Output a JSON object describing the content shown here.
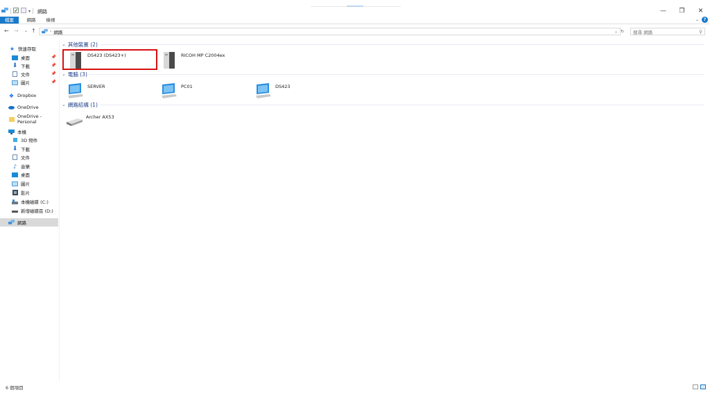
{
  "window": {
    "title": "網路",
    "minimize": "—",
    "maximize": "❐",
    "close": "✕"
  },
  "ribbon": {
    "tabs": [
      "檔案",
      "網路",
      "檢視"
    ],
    "help": "?"
  },
  "address": {
    "path": "網路",
    "search_placeholder": "搜尋 網路"
  },
  "nav": {
    "quick_access": "快速存取",
    "quick_items": [
      "桌面",
      "下載",
      "文件",
      "圖片"
    ],
    "dropbox": "Dropbox",
    "onedrive": "OneDrive",
    "onedrive_personal": "OneDrive - Personal",
    "this_pc": "本機",
    "pc_items": [
      "3D 物件",
      "下載",
      "文件",
      "音樂",
      "桌面",
      "圖片",
      "影片",
      "本機磁碟 (C:)",
      "新增磁碟區 (D:)"
    ],
    "network": "網路"
  },
  "groups": {
    "other_devices": {
      "header": "其他裝置 (2)",
      "items": [
        "DS423 (DS423+)",
        "RICOH MP C2004ex"
      ]
    },
    "computers": {
      "header": "電腦 (3)",
      "items": [
        "SERVER",
        "PC01",
        "DS423"
      ]
    },
    "network_infra": {
      "header": "網路結構 (1)",
      "items": [
        "Archer AX53"
      ]
    }
  },
  "status": {
    "count": "6 個項目"
  },
  "colors": {
    "accent": "#1979ca",
    "group_header": "#1e3f8a",
    "highlight": "#d60e0e"
  }
}
